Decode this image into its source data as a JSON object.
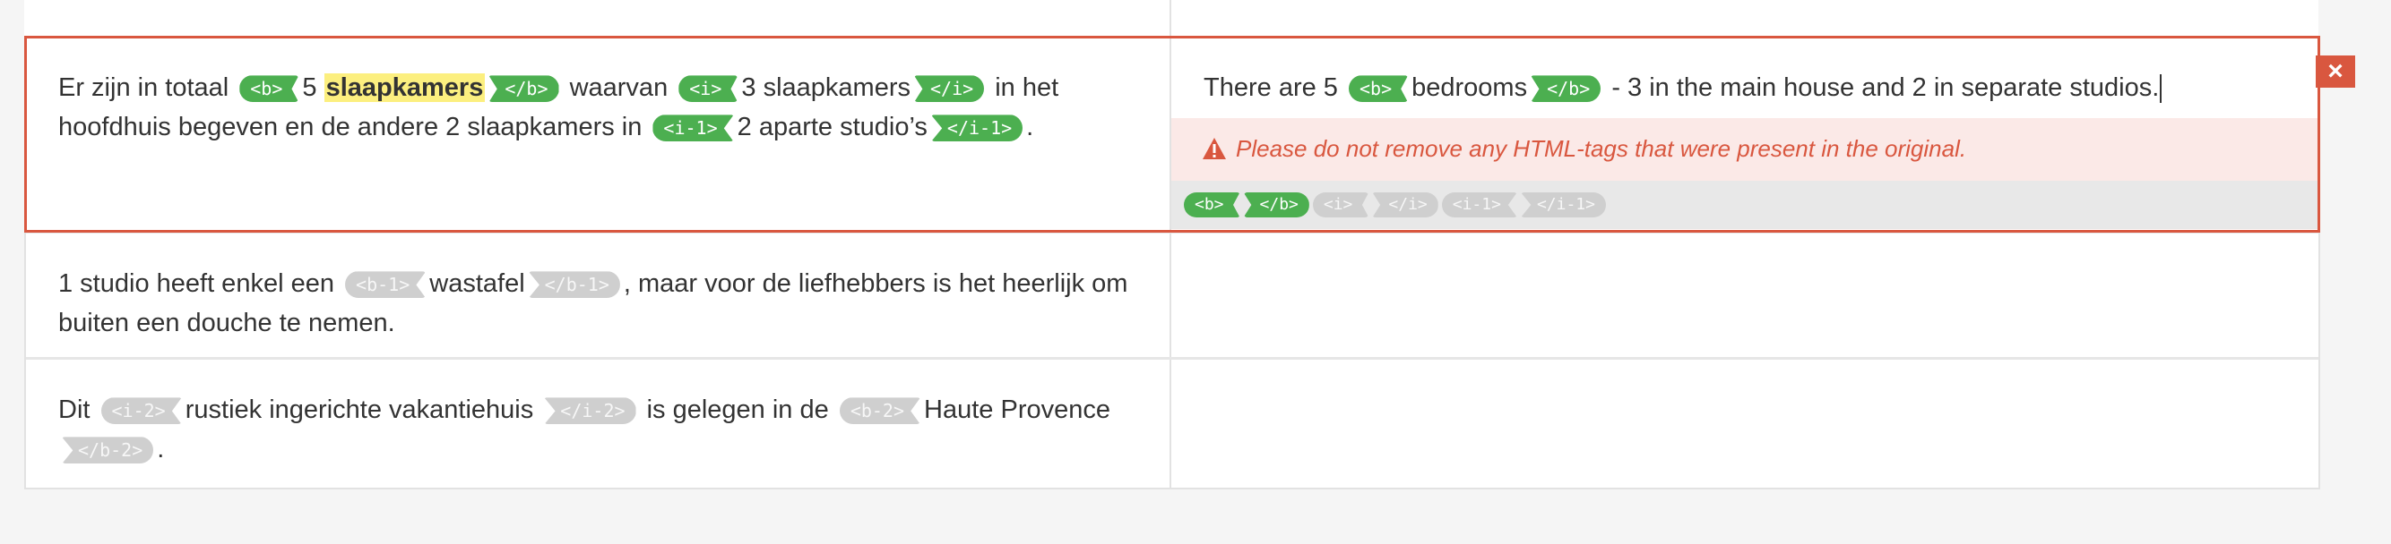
{
  "rows": [
    {
      "source": {
        "t1": "Er zijn in totaal",
        "tag_b_open": "<b>",
        "t2": "5",
        "highlight": "slaapkamers",
        "tag_b_close": "</b>",
        "t3": "waarvan",
        "tag_i_open": "<i>",
        "t4": "3 slaapkamers",
        "tag_i_close": "</i>",
        "t5": "in het hoofdhuis begeven en de andere 2 slaapkamers in",
        "tag_i1_open": "<i-1>",
        "t6": "2 aparte studio’s",
        "tag_i1_close": "</i-1>",
        "t7": "."
      },
      "target": {
        "t1": "There are 5",
        "tag_b_open": "<b>",
        "t2": "bedrooms",
        "tag_b_close": "</b>",
        "t3": "- 3 in the main house and 2 in separate studios.",
        "warning": "Please do not remove any HTML-tags that were present in the original.",
        "tagbar": [
          "<b>",
          "</b>",
          "<i>",
          "</i>",
          "<i-1>",
          "</i-1>"
        ]
      }
    },
    {
      "source": {
        "t1": "1 studio heeft enkel een",
        "tag_b1_open": "<b-1>",
        "t2": "wastafel",
        "tag_b1_close": "</b-1>",
        "t3": ", maar voor de liefhebbers is het heerlijk om buiten een douche te nemen."
      }
    },
    {
      "source": {
        "t1": "Dit",
        "tag_i2_open": "<i-2>",
        "t2": "rustiek ingerichte vakantiehuis",
        "tag_i2_close": "</i-2>",
        "t3": "is gelegen in de",
        "tag_b2_open": "<b-2>",
        "t4": "Haute Provence",
        "tag_b2_close": "</b-2>",
        "t5": "."
      }
    }
  ],
  "close_button": "×",
  "colors": {
    "accent": "#d9573f",
    "tag_green": "#4caf50",
    "tag_grey": "#cfcfcf",
    "highlight": "#fcef7f"
  },
  "icons": {
    "warning": "warning-triangle-icon",
    "close": "close-icon"
  }
}
